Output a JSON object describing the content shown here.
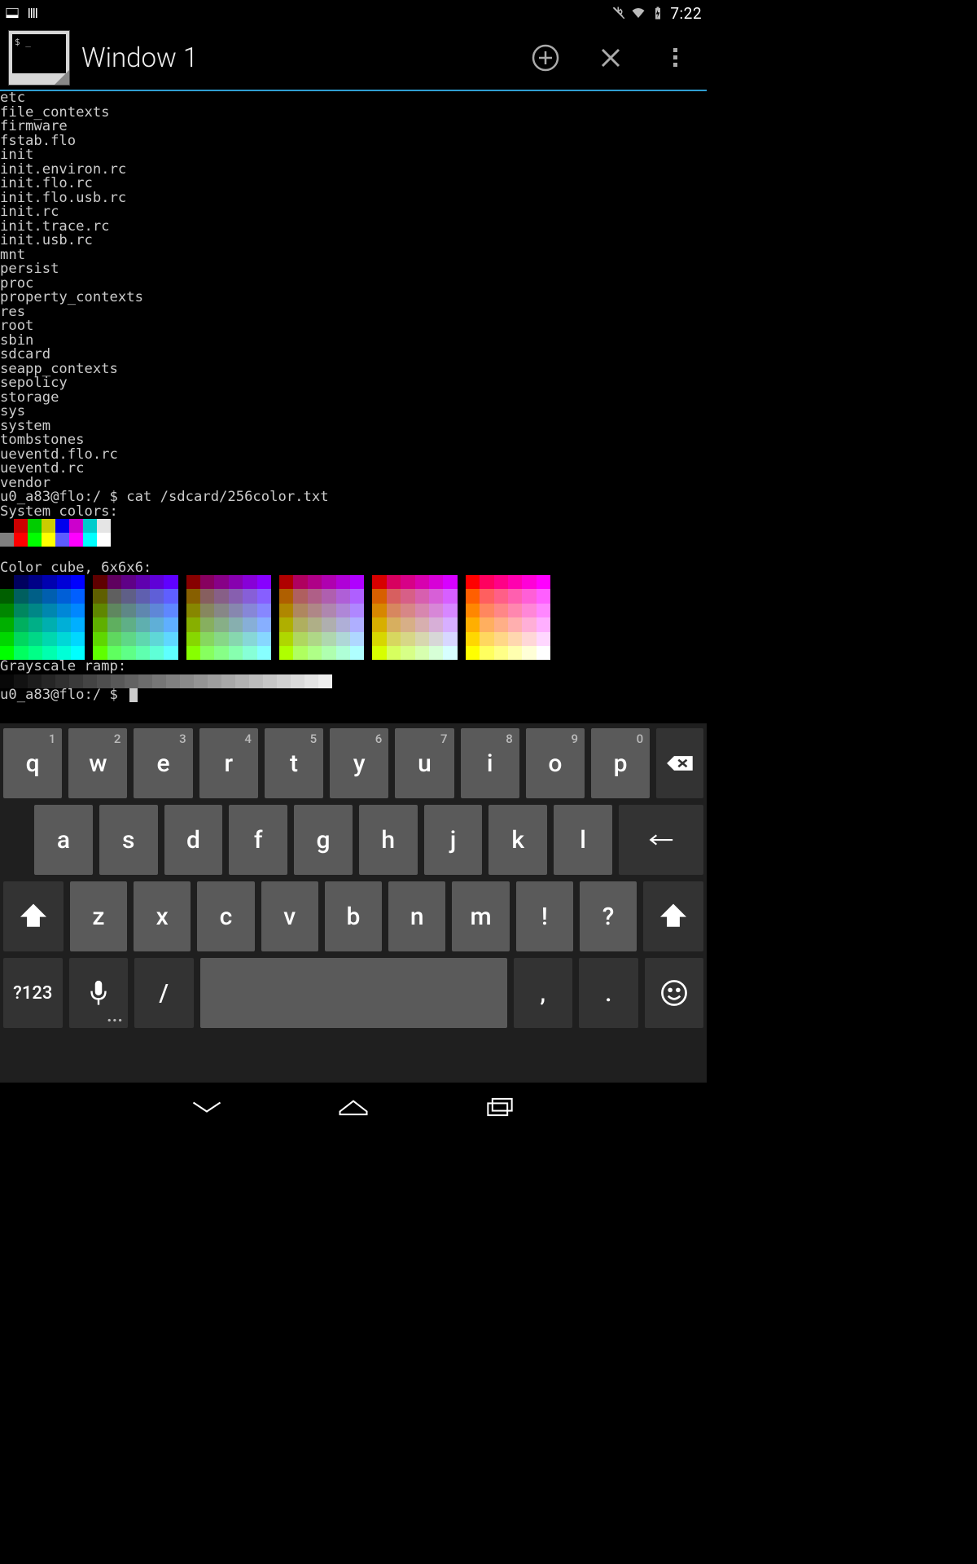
{
  "status_bar": {
    "clock": "7:22"
  },
  "header": {
    "title": "Window 1",
    "thumb_prompt": "$ _"
  },
  "terminal": {
    "lines": [
      "etc",
      "file_contexts",
      "firmware",
      "fstab.flo",
      "init",
      "init.environ.rc",
      "init.flo.rc",
      "init.flo.usb.rc",
      "init.rc",
      "init.trace.rc",
      "init.usb.rc",
      "mnt",
      "persist",
      "proc",
      "property_contexts",
      "res",
      "root",
      "sbin",
      "sdcard",
      "seapp_contexts",
      "sepolicy",
      "storage",
      "sys",
      "system",
      "tombstones",
      "ueventd.flo.rc",
      "ueventd.rc",
      "vendor"
    ],
    "cmd_line": "u0_a83@flo:/ $ cat /sdcard/256color.txt",
    "label_system": "System colors:",
    "system_colors_row1": [
      "#000000",
      "#cc0000",
      "#00cc00",
      "#cccc00",
      "#0000ee",
      "#cc00cc",
      "#00cccc",
      "#e5e5e5"
    ],
    "system_colors_row2": [
      "#7f7f7f",
      "#ff0000",
      "#00ff00",
      "#ffff00",
      "#5c5cff",
      "#ff00ff",
      "#00ffff",
      "#ffffff"
    ],
    "label_cube": "Color cube, 6x6x6:",
    "cube_levels": [
      0,
      95,
      135,
      175,
      215,
      255
    ],
    "label_gray": "Grayscale ramp:",
    "grayscale_count": 24,
    "prompt": "u0_a83@flo:/ $ "
  },
  "keyboard": {
    "row1": [
      {
        "k": "q",
        "n": "1"
      },
      {
        "k": "w",
        "n": "2"
      },
      {
        "k": "e",
        "n": "3"
      },
      {
        "k": "r",
        "n": "4"
      },
      {
        "k": "t",
        "n": "5"
      },
      {
        "k": "y",
        "n": "6"
      },
      {
        "k": "u",
        "n": "7"
      },
      {
        "k": "i",
        "n": "8"
      },
      {
        "k": "o",
        "n": "9"
      },
      {
        "k": "p",
        "n": "0"
      }
    ],
    "row2": [
      "a",
      "s",
      "d",
      "f",
      "g",
      "h",
      "j",
      "k",
      "l"
    ],
    "row3": [
      "z",
      "x",
      "c",
      "v",
      "b",
      "n",
      "m",
      "!",
      "?"
    ],
    "sym_key": "?123",
    "slash_key": "/",
    "comma_key": ",",
    "period_key": ".",
    "mic_sub": "..."
  }
}
